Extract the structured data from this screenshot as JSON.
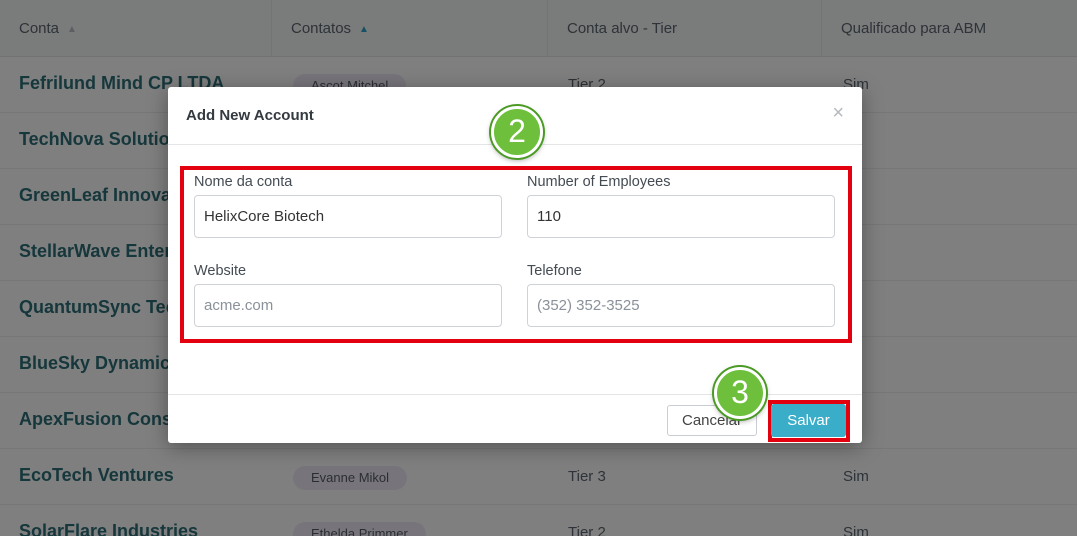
{
  "table": {
    "columns": [
      {
        "label": "Conta",
        "sort": "none"
      },
      {
        "label": "Contatos",
        "sort": "asc"
      },
      {
        "label": "Conta alvo - Tier",
        "sort": ""
      },
      {
        "label": "Qualificado para ABM",
        "sort": ""
      }
    ],
    "rows": [
      {
        "name": "Fefrilund Mind CP LTDA",
        "contact": "Ascot Mitchel",
        "tier": "Tier 2",
        "abm": "Sim"
      },
      {
        "name": "TechNova Solutions",
        "contact": "",
        "tier": "",
        "abm": ""
      },
      {
        "name": "GreenLeaf Innovations",
        "contact": "",
        "tier": "",
        "abm": ""
      },
      {
        "name": "StellarWave Enterprises",
        "contact": "",
        "tier": "",
        "abm": ""
      },
      {
        "name": "QuantumSync Technologies",
        "contact": "",
        "tier": "",
        "abm": ""
      },
      {
        "name": "BlueSky Dynamics",
        "contact": "",
        "tier": "",
        "abm": ""
      },
      {
        "name": "ApexFusion Consulting",
        "contact": "",
        "tier": "",
        "abm": ""
      },
      {
        "name": "EcoTech Ventures",
        "contact": "Evanne Mikol",
        "tier": "Tier 3",
        "abm": "Sim"
      },
      {
        "name": "SolarFlare Industries",
        "contact": "Ethelda Primmer",
        "tier": "Tier 2",
        "abm": "Sim"
      }
    ]
  },
  "modal": {
    "title": "Add New Account",
    "close_symbol": "×",
    "fields": {
      "account_name": {
        "label": "Nome da conta",
        "value": "HelixCore Biotech",
        "placeholder": ""
      },
      "employees": {
        "label": "Number of Employees",
        "value": "110",
        "placeholder": ""
      },
      "website": {
        "label": "Website",
        "value": "",
        "placeholder": "acme.com"
      },
      "phone": {
        "label": "Telefone",
        "value": "",
        "placeholder": "(352) 352-3525"
      }
    },
    "cancel_label": "Cancelar",
    "save_label": "Salvar"
  },
  "steps": {
    "form": "2",
    "save": "3"
  },
  "colors": {
    "highlight": "#e3000f",
    "step_marker": "#6dbf3c",
    "save_button": "#3aaec8",
    "account_link": "#2c6e77"
  }
}
